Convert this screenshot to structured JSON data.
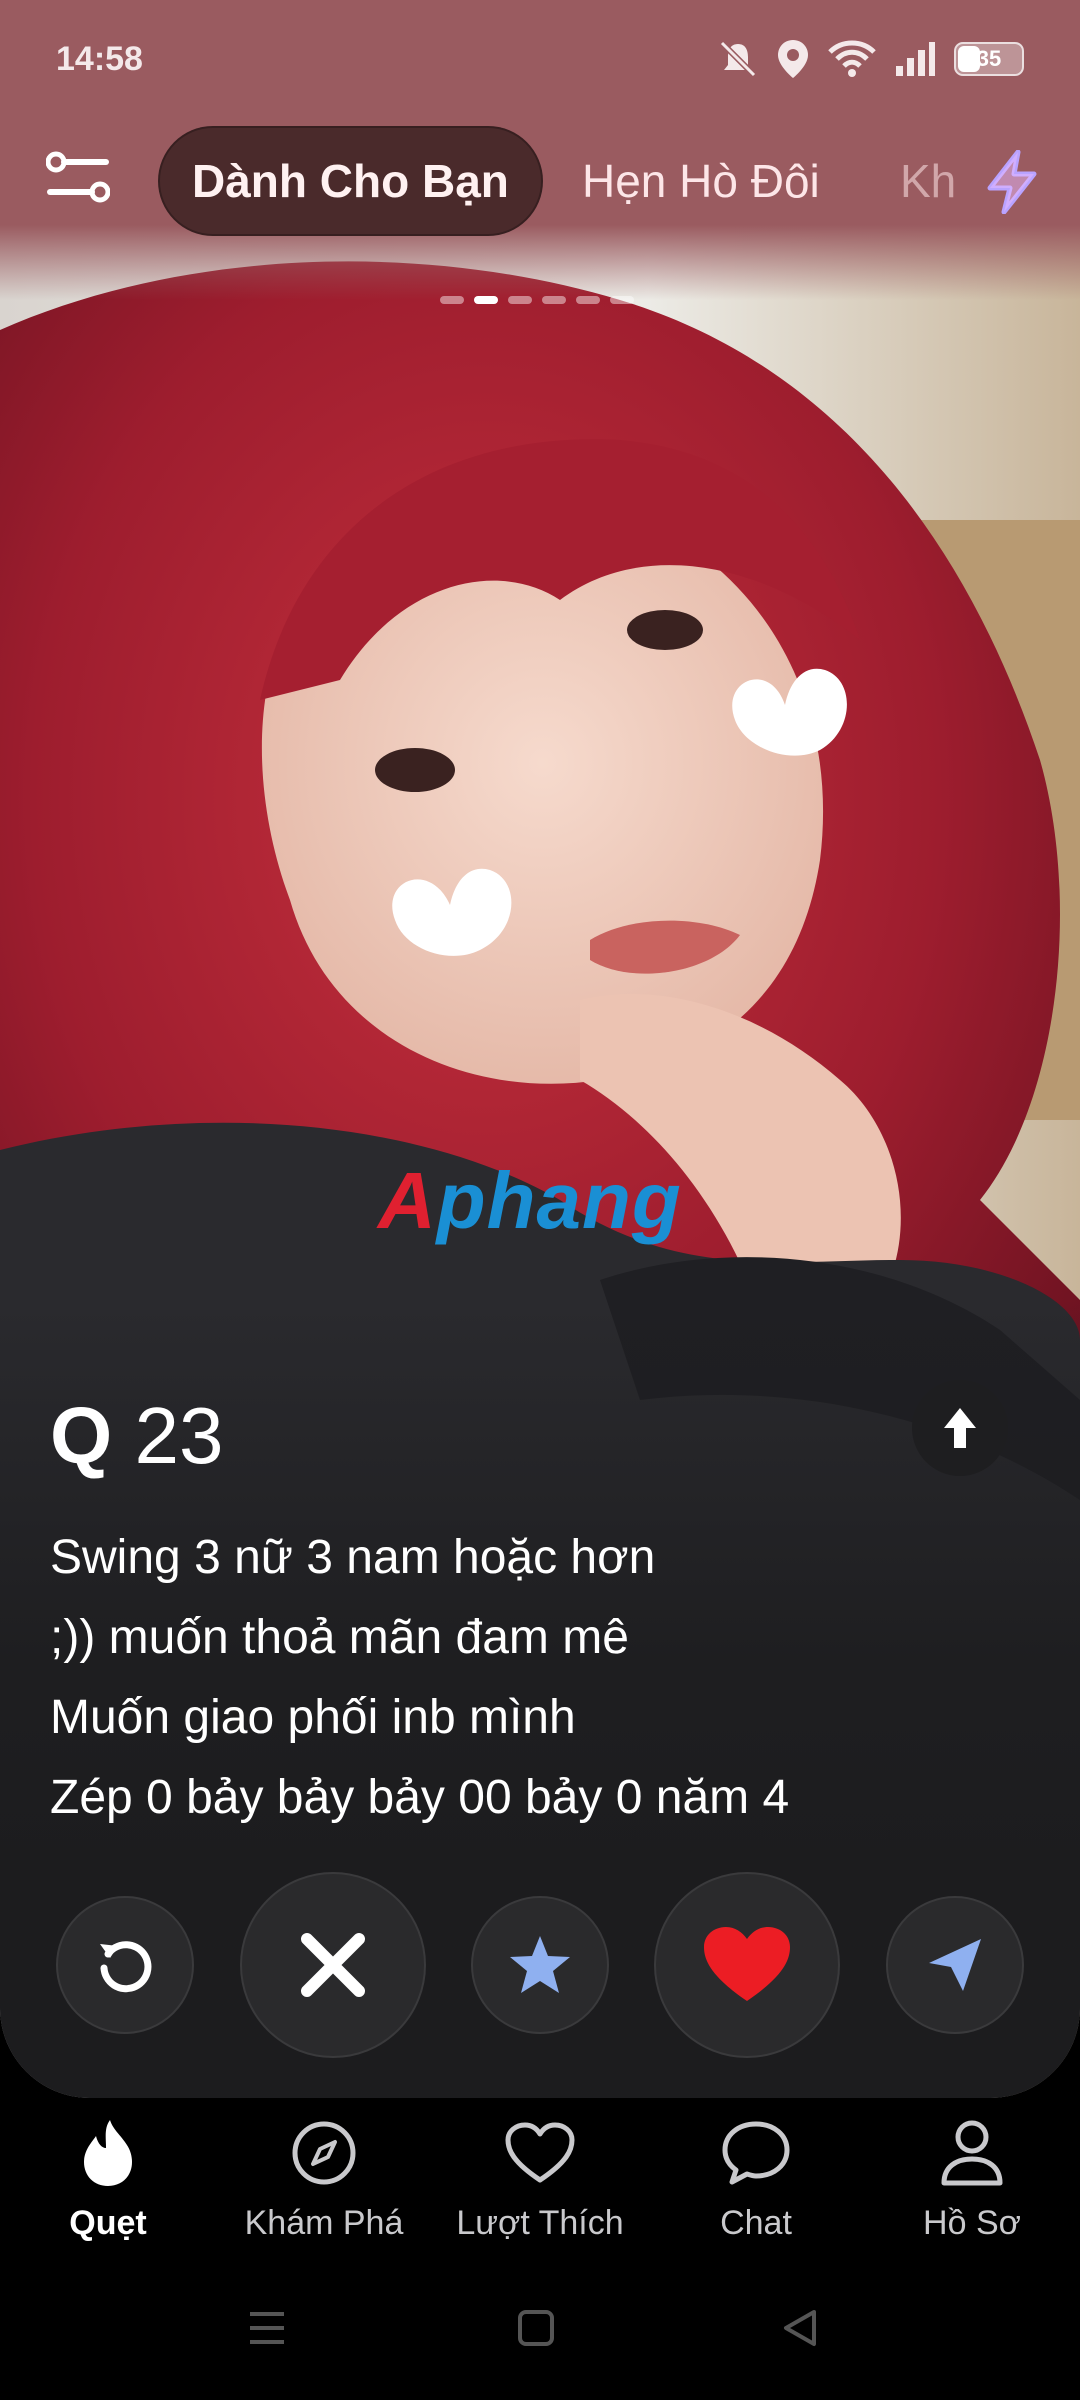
{
  "status_bar": {
    "time": "14:58",
    "battery": "35",
    "icons": [
      "mute-icon",
      "location-icon",
      "wifi-icon",
      "signal-icon",
      "battery-icon"
    ]
  },
  "top_nav": {
    "filter_icon": "sliders-icon",
    "tabs": [
      {
        "label": "Dành Cho Bạn",
        "active": true
      },
      {
        "label": "Hẹn Hò Đôi",
        "active": false
      },
      {
        "label": "Kh",
        "active": false
      }
    ],
    "boost_icon": "lightning-icon",
    "boost_color": "#b9a3ff"
  },
  "photo": {
    "count": 6,
    "current": 2
  },
  "watermark": {
    "part_a": "A",
    "part_b": "phang"
  },
  "profile": {
    "name": "Q",
    "age": "23",
    "bio": [
      "Swing 3 nữ 3 nam hoặc hơn",
      ";)) muốn thoả mãn đam mê",
      "Muốn giao phối inb mình",
      "Zép 0 bảy bảy bảy 00 bảy 0 năm 4"
    ]
  },
  "actions": [
    {
      "name": "rewind-button",
      "icon": "rewind-icon",
      "color": "#ffffff"
    },
    {
      "name": "nope-button",
      "icon": "close-icon",
      "color": "#ffffff"
    },
    {
      "name": "super-like-button",
      "icon": "star-icon",
      "color": "#8fb0f0"
    },
    {
      "name": "like-button",
      "icon": "heart-icon",
      "color": "#ec1d24"
    },
    {
      "name": "boost-send-button",
      "icon": "send-icon",
      "color": "#8fb0f0"
    }
  ],
  "bottom_nav": [
    {
      "label": "Quẹt",
      "icon": "flame-icon",
      "active": true
    },
    {
      "label": "Khám Phá",
      "icon": "compass-icon",
      "active": false
    },
    {
      "label": "Lượt Thích",
      "icon": "heart-outline-icon",
      "active": false
    },
    {
      "label": "Chat",
      "icon": "chat-icon",
      "active": false
    },
    {
      "label": "Hồ Sơ",
      "icon": "profile-icon",
      "active": false
    }
  ],
  "system_nav": [
    "recents-icon",
    "home-icon",
    "back-icon"
  ]
}
